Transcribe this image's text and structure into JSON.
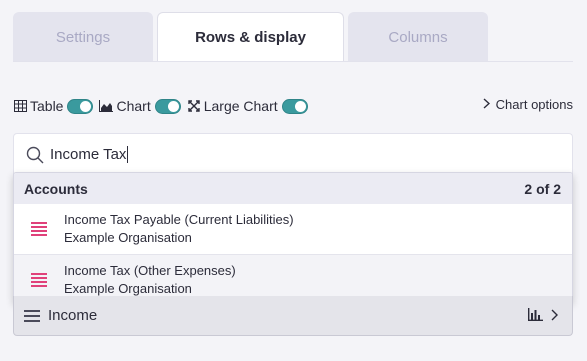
{
  "tabs": [
    {
      "label": "Settings"
    },
    {
      "label": "Rows & display"
    },
    {
      "label": "Columns"
    }
  ],
  "toggles": {
    "table": {
      "label": "Table",
      "icon": "table-icon",
      "on": true
    },
    "chart": {
      "label": "Chart",
      "icon": "area-chart-icon",
      "on": true
    },
    "large_chart": {
      "label": "Large Chart",
      "icon": "expand-icon",
      "on": true
    }
  },
  "chart_options": {
    "label": "Chart options",
    "icon": "chevron-right-icon"
  },
  "search": {
    "value": "Income Tax",
    "icon": "search-icon"
  },
  "dropdown": {
    "title": "Accounts",
    "count": "2 of 2",
    "items": [
      {
        "line1": "Income Tax Payable (Current Liabilities)",
        "line2": "Example Organisation",
        "icon": "account-icon"
      },
      {
        "line1": "Income Tax (Other Expenses)",
        "line2": "Example Organisation",
        "icon": "account-icon"
      }
    ]
  },
  "income_row": {
    "label": "Income",
    "icon": "menu-icon"
  },
  "colors": {
    "accent": "#3a9a9e",
    "account_icon": "#e0417a",
    "background": "#f4f4f8"
  }
}
